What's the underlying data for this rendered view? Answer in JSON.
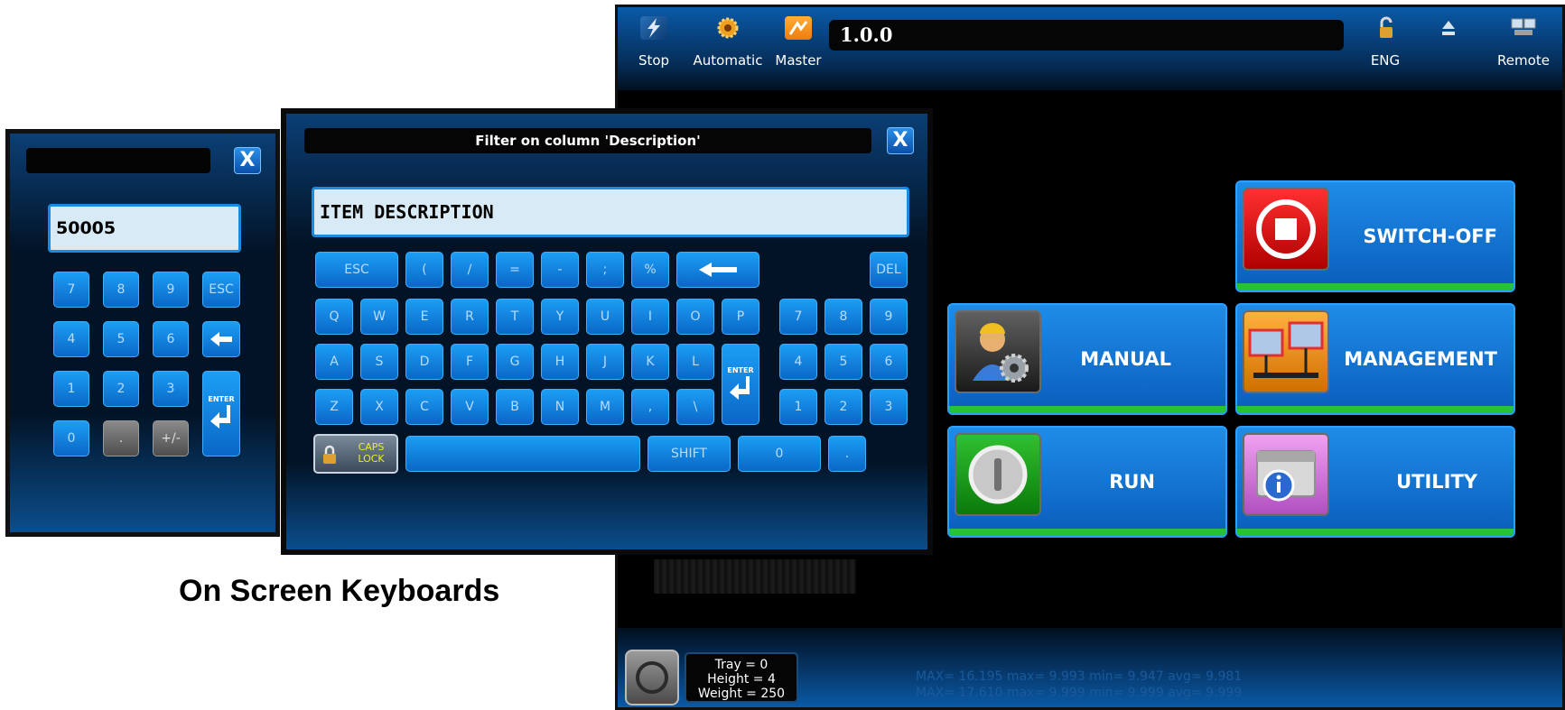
{
  "caption": "On Screen Keyboards",
  "hmi": {
    "toolbar": {
      "stop_label": "Stop",
      "automatic_label": "Automatic",
      "master_label": "Master",
      "version": "1.0.0",
      "lang_label": "ENG",
      "remote_label": "Remote"
    },
    "menu": {
      "switch_off": "SWITCH-OFF",
      "manual": "MANUAL",
      "management": "MANAGEMENT",
      "run": "RUN",
      "utility": "UTILITY"
    },
    "status": {
      "tray": "Tray = 0",
      "height": "Height = 4",
      "weight": "Weight  = 250"
    },
    "stats": {
      "line1": "MAX= 16.195 max= 9.993  min= 9.947  avg= 9.981",
      "line2": "MAX= 17.610 max= 9.999  min= 9.999  avg= 9.999"
    }
  },
  "numpad": {
    "close": "X",
    "value": "50005",
    "keys": [
      "7",
      "8",
      "9",
      "ESC",
      "4",
      "5",
      "6",
      "1",
      "2",
      "3",
      "0",
      ".",
      "+/-"
    ],
    "enter": "ENTER"
  },
  "keyboard": {
    "title": "Filter on column 'Description'",
    "close": "X",
    "value": "ITEM DESCRIPTION",
    "row0": [
      "ESC",
      "(",
      "/",
      "=",
      "-",
      ";",
      "%"
    ],
    "del": "DEL",
    "row1": [
      "Q",
      "W",
      "E",
      "R",
      "T",
      "Y",
      "U",
      "I",
      "O",
      "P"
    ],
    "row2": [
      "A",
      "S",
      "D",
      "F",
      "G",
      "H",
      "J",
      "K",
      "L"
    ],
    "row3": [
      "Z",
      "X",
      "C",
      "V",
      "B",
      "N",
      "M",
      ",",
      "\\"
    ],
    "num1": [
      "7",
      "8",
      "9"
    ],
    "num2": [
      "4",
      "5",
      "6"
    ],
    "num3": [
      "1",
      "2",
      "3"
    ],
    "caps": "CAPS LOCK",
    "shift": "SHIFT",
    "zero": "0",
    "dot": ".",
    "enter": "ENTER"
  },
  "colors": {
    "accent_blue": "#1c9ef5",
    "status_green": "#26c23a",
    "switch_off_red": "#d81818",
    "run_green": "#1a9a1a"
  }
}
